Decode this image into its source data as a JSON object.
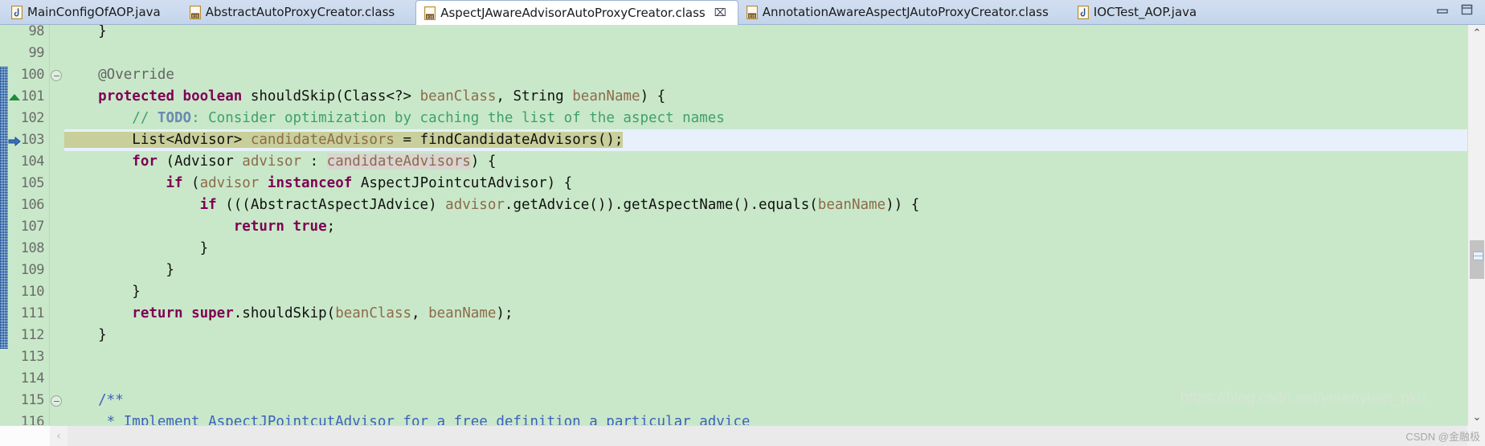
{
  "window": {
    "minimize_label": "Minimize",
    "maximize_label": "Maximize"
  },
  "tabs": [
    {
      "label": "MainConfigOfAOP.java",
      "icon": "java-file-icon",
      "active": false,
      "closable": false
    },
    {
      "label": "AbstractAutoProxyCreator.class",
      "icon": "class-file-icon",
      "active": false,
      "closable": false
    },
    {
      "label": "AspectJAwareAdvisorAutoProxyCreator.class",
      "icon": "class-file-icon",
      "active": true,
      "closable": true,
      "close_glyph": "⌧"
    },
    {
      "label": "AnnotationAwareAspectJAutoProxyCreator.class",
      "icon": "class-file-icon",
      "active": false,
      "closable": false
    },
    {
      "label": "IOCTest_AOP.java",
      "icon": "java-file-icon",
      "active": false,
      "closable": false
    }
  ],
  "editor": {
    "first_line": 98,
    "current_line": 103,
    "selection_text": "List<Advisor> candidateAdvisors = findCandidateAdvisors();",
    "occurrence_text": "candidateAdvisors",
    "lines": [
      {
        "n": 98,
        "text": "\t}"
      },
      {
        "n": 99,
        "text": ""
      },
      {
        "n": 100,
        "text": "\t@Override"
      },
      {
        "n": 101,
        "text": "\tprotected boolean shouldSkip(Class<?> beanClass, String beanName) {"
      },
      {
        "n": 102,
        "text": "\t\t// TODO: Consider optimization by caching the list of the aspect names"
      },
      {
        "n": 103,
        "text": "\t\tList<Advisor> candidateAdvisors = findCandidateAdvisors();"
      },
      {
        "n": 104,
        "text": "\t\tfor (Advisor advisor : candidateAdvisors) {"
      },
      {
        "n": 105,
        "text": "\t\t\tif (advisor instanceof AspectJPointcutAdvisor) {"
      },
      {
        "n": 106,
        "text": "\t\t\t\tif (((AbstractAspectJAdvice) advisor.getAdvice()).getAspectName().equals(beanName)) {"
      },
      {
        "n": 107,
        "text": "\t\t\t\t\treturn true;"
      },
      {
        "n": 108,
        "text": "\t\t\t\t}"
      },
      {
        "n": 109,
        "text": "\t\t\t}"
      },
      {
        "n": 110,
        "text": "\t\t}"
      },
      {
        "n": 111,
        "text": "\t\treturn super.shouldSkip(beanClass, beanName);"
      },
      {
        "n": 112,
        "text": "\t}"
      },
      {
        "n": 113,
        "text": ""
      },
      {
        "n": 114,
        "text": ""
      },
      {
        "n": 115,
        "text": "\t/**"
      },
      {
        "n": 116,
        "text": "\t * Implement AspectJPointcutAdvisor for a free definition a particular advice"
      }
    ],
    "markers": {
      "fold_lines": [
        100,
        115
      ],
      "override_line": 101,
      "current_arrow_line": 103,
      "change_bar_start_line": 100,
      "change_bar_end_line": 112
    }
  },
  "scrollbars": {
    "v_up_glyph": "⌃",
    "v_down_glyph": "⌄",
    "h_left_glyph": "‹",
    "overview_label": "overview-ruler"
  },
  "watermark": {
    "url": "https://blog.csdn.net/yerenyuan_pku",
    "credit": "CSDN @金融极"
  },
  "colors": {
    "editor_background": "#c9e8c9",
    "current_line": "#e8f0fb",
    "selection": "#c8cf9a",
    "occurrence": "#d9d4d0",
    "keyword": "#7f0055",
    "comment": "#3f9f6f",
    "javadoc": "#3f5fbf",
    "parameter": "#8d6a4a",
    "annotation": "#646464",
    "tabbar": "#cbdaee",
    "change_bar": "#2f6fb5"
  }
}
